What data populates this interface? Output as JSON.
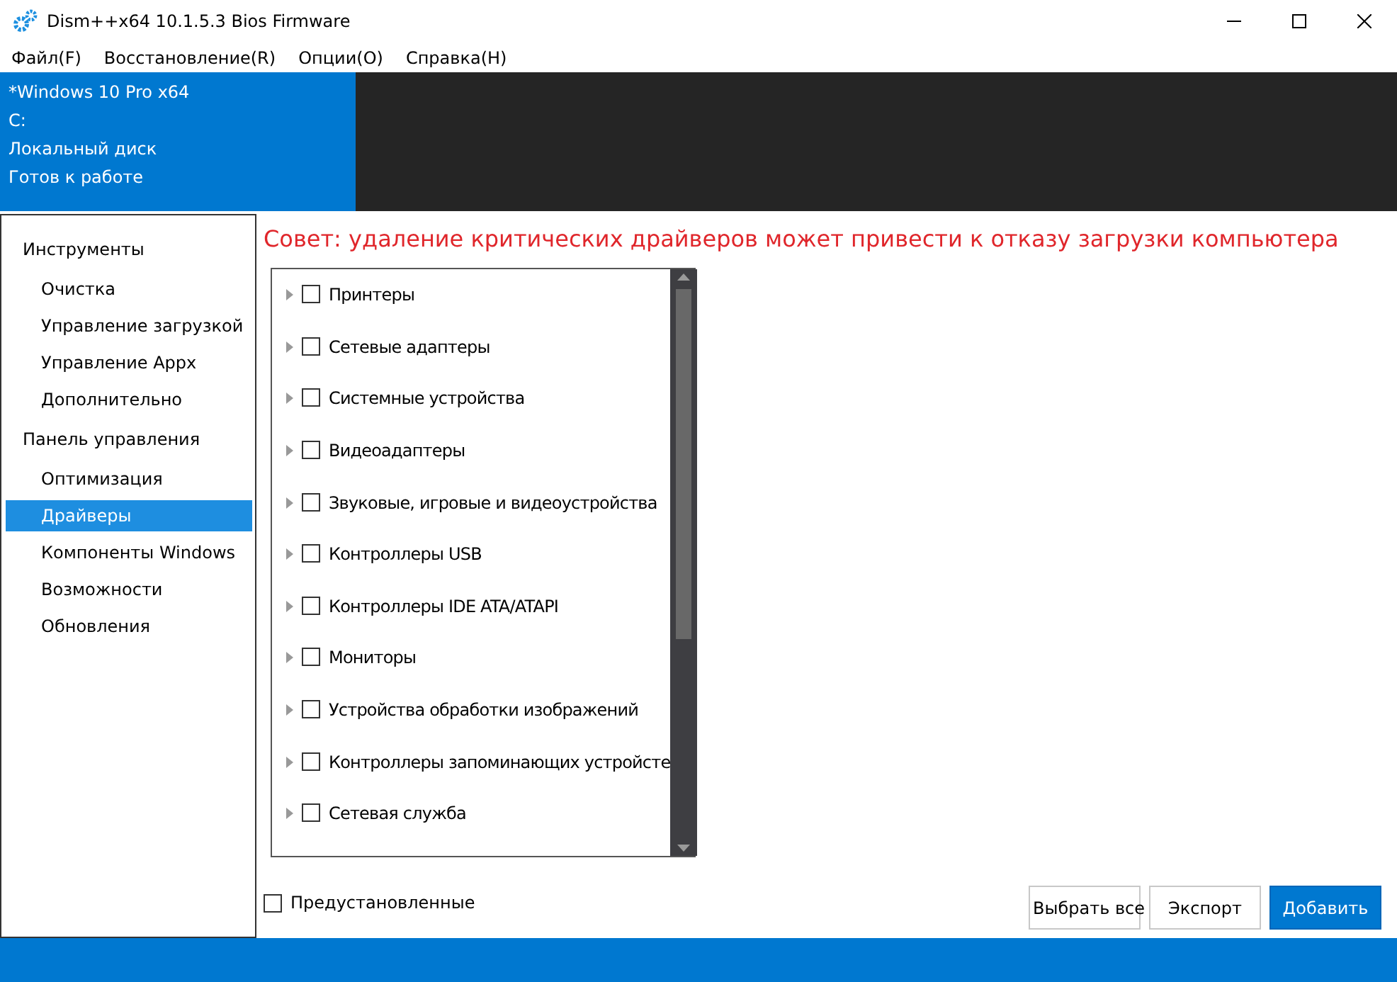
{
  "window": {
    "title": "Dism++x64 10.1.5.3 Bios Firmware"
  },
  "menu": [
    "Файл(F)",
    "Восстановление(R)",
    "Опции(O)",
    "Справка(H)"
  ],
  "image_info": [
    "*Windows 10 Pro x64",
    "C:",
    "Локальный диск",
    "Готов к работе"
  ],
  "sidebar": [
    {
      "label": "Инструменты",
      "items": [
        {
          "label": "Очистка",
          "selected": false
        },
        {
          "label": "Управление загрузкой",
          "selected": false
        },
        {
          "label": "Управление Appx",
          "selected": false
        },
        {
          "label": "Дополнительно",
          "selected": false
        }
      ]
    },
    {
      "label": "Панель управления",
      "items": [
        {
          "label": "Оптимизация",
          "selected": false
        },
        {
          "label": "Драйверы",
          "selected": true
        },
        {
          "label": "Компоненты Windows",
          "selected": false
        },
        {
          "label": "Возможности",
          "selected": false
        },
        {
          "label": "Обновления",
          "selected": false
        }
      ]
    }
  ],
  "tip": "Совет: удаление критических драйверов может привести к отказу загрузки компьютера",
  "drivers": [
    {
      "label": "Принтеры",
      "checked": false,
      "expanded": false
    },
    {
      "label": "Сетевые адаптеры",
      "checked": false,
      "expanded": false
    },
    {
      "label": "Системные устройства",
      "checked": false,
      "expanded": false
    },
    {
      "label": "Видеоадаптеры",
      "checked": false,
      "expanded": false
    },
    {
      "label": "Звуковые, игровые и видеоустройства",
      "checked": false,
      "expanded": false
    },
    {
      "label": "Контроллеры USB",
      "checked": false,
      "expanded": false
    },
    {
      "label": "Контроллеры IDE ATA/ATAPI",
      "checked": false,
      "expanded": false
    },
    {
      "label": "Мониторы",
      "checked": false,
      "expanded": false
    },
    {
      "label": "Устройства обработки изображений",
      "checked": false,
      "expanded": false
    },
    {
      "label": "Контроллеры запоминающих устройсте",
      "checked": false,
      "expanded": false
    },
    {
      "label": "Сетевая служба",
      "checked": false,
      "expanded": false
    }
  ],
  "preinstalled": {
    "label": "Предустановленные",
    "checked": false
  },
  "buttons": [
    {
      "label": "Выбрать все",
      "kind": "secondary"
    },
    {
      "label": "Экспорт",
      "kind": "secondary"
    },
    {
      "label": "Добавить",
      "kind": "primary"
    }
  ]
}
